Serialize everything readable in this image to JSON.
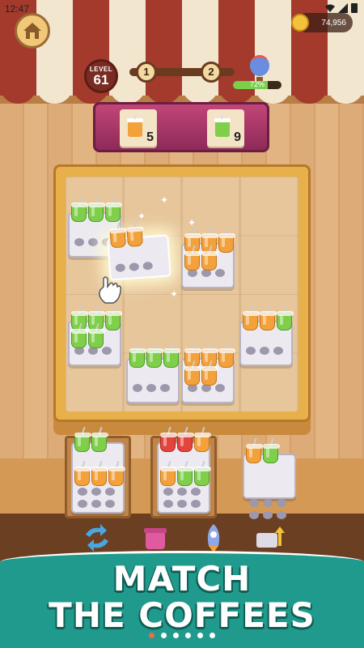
{
  "status_bar": {
    "time": "12:47"
  },
  "header": {
    "coins": "74,956",
    "level_label": "LEVEL",
    "level_number": "61",
    "stages": [
      "1",
      "2"
    ],
    "progress_percent": "72%",
    "progress_fraction": 0.72
  },
  "orders": [
    {
      "drink": "orange-iced-coffee",
      "count": "5"
    },
    {
      "drink": "green-iced-coffee",
      "count": "9"
    }
  ],
  "board": {
    "trays": [
      {
        "id": "tray-a",
        "cups": [
          "green",
          "green",
          "green"
        ]
      },
      {
        "id": "tray-selected",
        "cups": [
          "orange",
          "orange"
        ]
      },
      {
        "id": "tray-b",
        "cups": [
          "orange",
          "orange",
          "orange",
          "orange",
          "orange"
        ]
      },
      {
        "id": "tray-c",
        "cups": [
          "green",
          "green",
          "green",
          "green",
          "green"
        ]
      },
      {
        "id": "tray-d",
        "cups": [
          "orange",
          "orange",
          "green"
        ]
      },
      {
        "id": "tray-e",
        "cups": [
          "green",
          "green",
          "green"
        ]
      },
      {
        "id": "tray-f",
        "cups": [
          "orange",
          "orange",
          "orange",
          "orange",
          "orange"
        ]
      }
    ]
  },
  "queue_trays": [
    {
      "id": "queue-1",
      "top": [
        "green",
        "green"
      ],
      "bottom": [
        "orange",
        "orange",
        "orange"
      ]
    },
    {
      "id": "queue-2",
      "top": [
        "red",
        "red",
        "orange"
      ],
      "bottom": [
        "orange",
        "green",
        "green"
      ]
    },
    {
      "id": "queue-3",
      "top": [
        "orange",
        "green"
      ],
      "bottom": []
    }
  ],
  "boosters": [
    "shuffle-icon",
    "cup-icon",
    "rocket-icon",
    "swap-tray-icon"
  ],
  "banner": {
    "line1": "MATCH",
    "line2": "THE COFFEES",
    "pages": 6,
    "active_page": 1
  }
}
